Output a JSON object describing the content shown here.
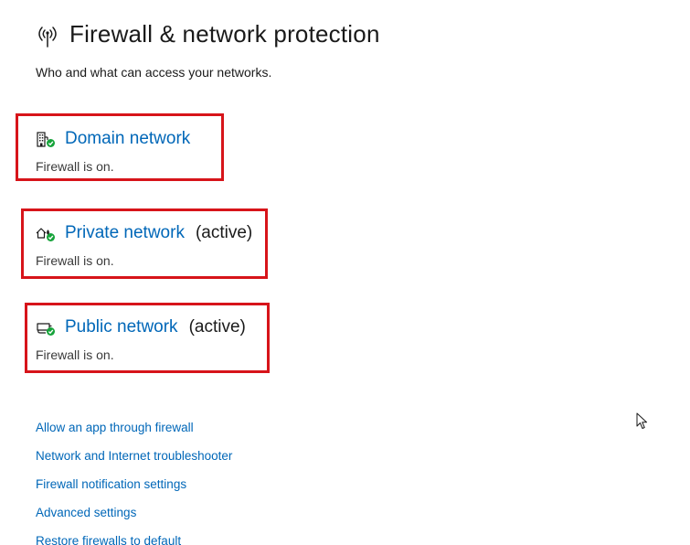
{
  "header": {
    "icon": "antenna-icon",
    "title": "Firewall & network protection",
    "subtitle": "Who and what can access your networks."
  },
  "networks": [
    {
      "icon": "domain-network-icon",
      "label": "Domain network",
      "active": "",
      "status": "Firewall is on."
    },
    {
      "icon": "private-network-icon",
      "label": "Private network",
      "active": "(active)",
      "status": "Firewall is on."
    },
    {
      "icon": "public-network-icon",
      "label": "Public network",
      "active": "(active)",
      "status": "Firewall is on."
    }
  ],
  "links": [
    "Allow an app through firewall",
    "Network and Internet troubleshooter",
    "Firewall notification settings",
    "Advanced settings",
    "Restore firewalls to default"
  ],
  "colors": {
    "link": "#0067b8",
    "highlight_box": "#d7141a",
    "status_ok": "#16a33a"
  }
}
